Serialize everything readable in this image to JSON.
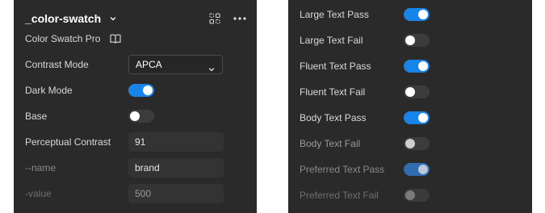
{
  "left_panel": {
    "title": "_color-swatch",
    "subtitle": "Color Swatch Pro",
    "icons": [
      "chevron-down-icon",
      "grid-icon",
      "more-icon",
      "book-icon"
    ],
    "contrast_mode": {
      "label": "Contrast Mode",
      "value": "APCA"
    },
    "dark_mode": {
      "label": "Dark Mode",
      "on": true
    },
    "base": {
      "label": "Base",
      "on": false
    },
    "perceptual_contrast": {
      "label": "Perceptual Contrast",
      "value": "91"
    },
    "name": {
      "label": "--name",
      "value": "brand"
    },
    "value": {
      "label": "-value",
      "value": "500"
    }
  },
  "right_panel": {
    "items": [
      {
        "label": "Large Text Pass",
        "on": true
      },
      {
        "label": "Large Text Fail",
        "on": false
      },
      {
        "label": "Fluent Text Pass",
        "on": true
      },
      {
        "label": "Fluent Text Fail",
        "on": false
      },
      {
        "label": "Body Text Pass",
        "on": true
      },
      {
        "label": "Body Text Fail",
        "on": false
      },
      {
        "label": "Preferred Text Pass",
        "on": true
      },
      {
        "label": "Preferred Text Fail",
        "on": false
      }
    ]
  },
  "colors": {
    "panel_bg": "#2a2a2a",
    "toggle_on": "#1784e9",
    "toggle_off": "#3c3c3c"
  }
}
